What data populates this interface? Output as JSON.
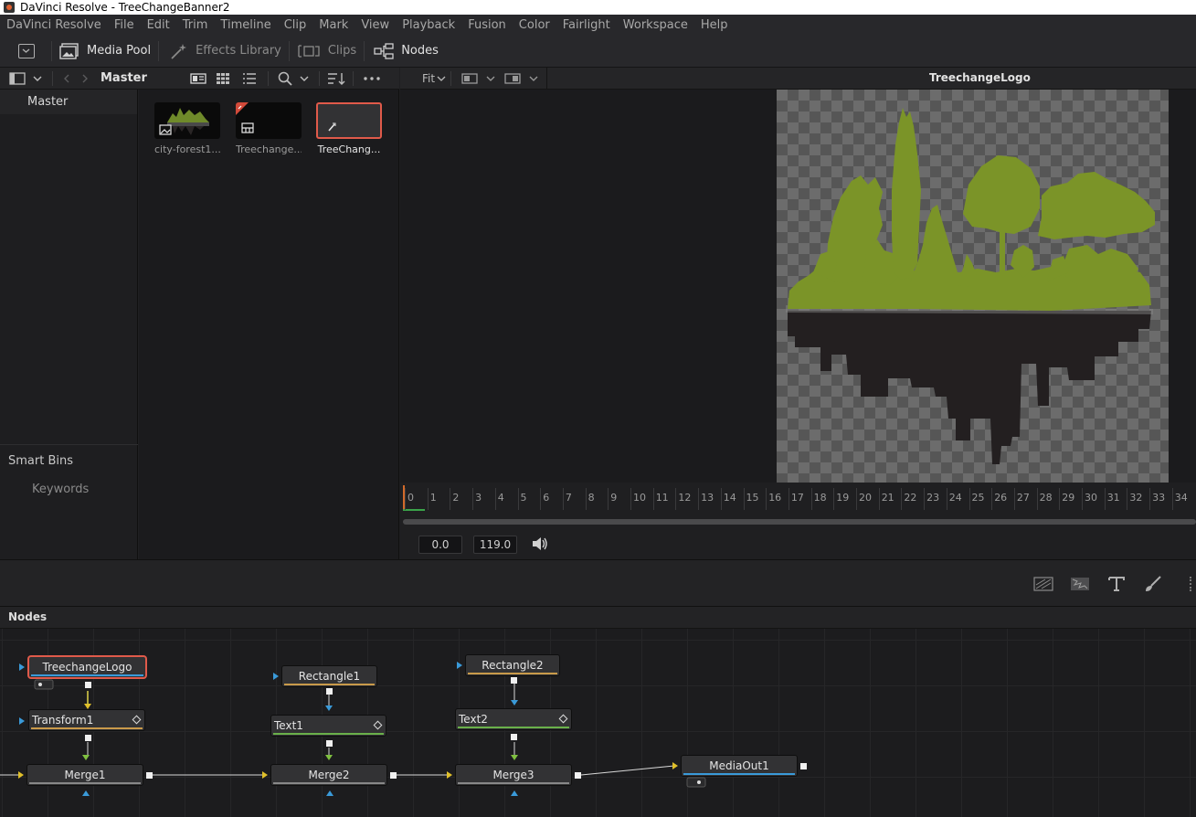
{
  "window": {
    "title": "DaVinci Resolve - TreeChangeBanner2"
  },
  "menu": [
    "DaVinci Resolve",
    "File",
    "Edit",
    "Trim",
    "Timeline",
    "Clip",
    "Mark",
    "View",
    "Playback",
    "Fusion",
    "Color",
    "Fairlight",
    "Workspace",
    "Help"
  ],
  "toolbar": {
    "media_pool": "Media Pool",
    "effects_library": "Effects Library",
    "clips": "Clips",
    "nodes": "Nodes"
  },
  "media_pool": {
    "bin_title": "Master",
    "bins": {
      "master": "Master",
      "smart_bins": "Smart Bins",
      "keywords": "Keywords"
    },
    "clips": [
      {
        "name": "city-forest1...",
        "selected": false
      },
      {
        "name": "Treechange...",
        "selected": false
      },
      {
        "name": "TreeChang...",
        "selected": true
      }
    ]
  },
  "viewer": {
    "zoom": "Fit",
    "title": "TreechangeLogo",
    "ruler_ticks": [
      "0",
      "1",
      "2",
      "3",
      "4",
      "5",
      "6",
      "7",
      "8",
      "9",
      "10",
      "11",
      "12",
      "13",
      "14",
      "15",
      "16",
      "17",
      "18",
      "19",
      "20",
      "21",
      "22",
      "23",
      "24",
      "25",
      "26",
      "27",
      "28",
      "29",
      "30",
      "31",
      "32",
      "33",
      "34"
    ],
    "start_time": "0.0",
    "end_time": "119.0"
  },
  "nodes_panel": {
    "title": "Nodes",
    "nodes": {
      "treechange_logo": "TreechangeLogo",
      "transform1": "Transform1",
      "merge1": "Merge1",
      "rectangle1": "Rectangle1",
      "text1": "Text1",
      "merge2": "Merge2",
      "rectangle2": "Rectangle2",
      "text2": "Text2",
      "merge3": "Merge3",
      "media_out1": "MediaOut1"
    }
  },
  "colors": {
    "accent_selected": "#e05a4a",
    "tree_green": "#7b9428",
    "ground_dark": "#231f20"
  }
}
